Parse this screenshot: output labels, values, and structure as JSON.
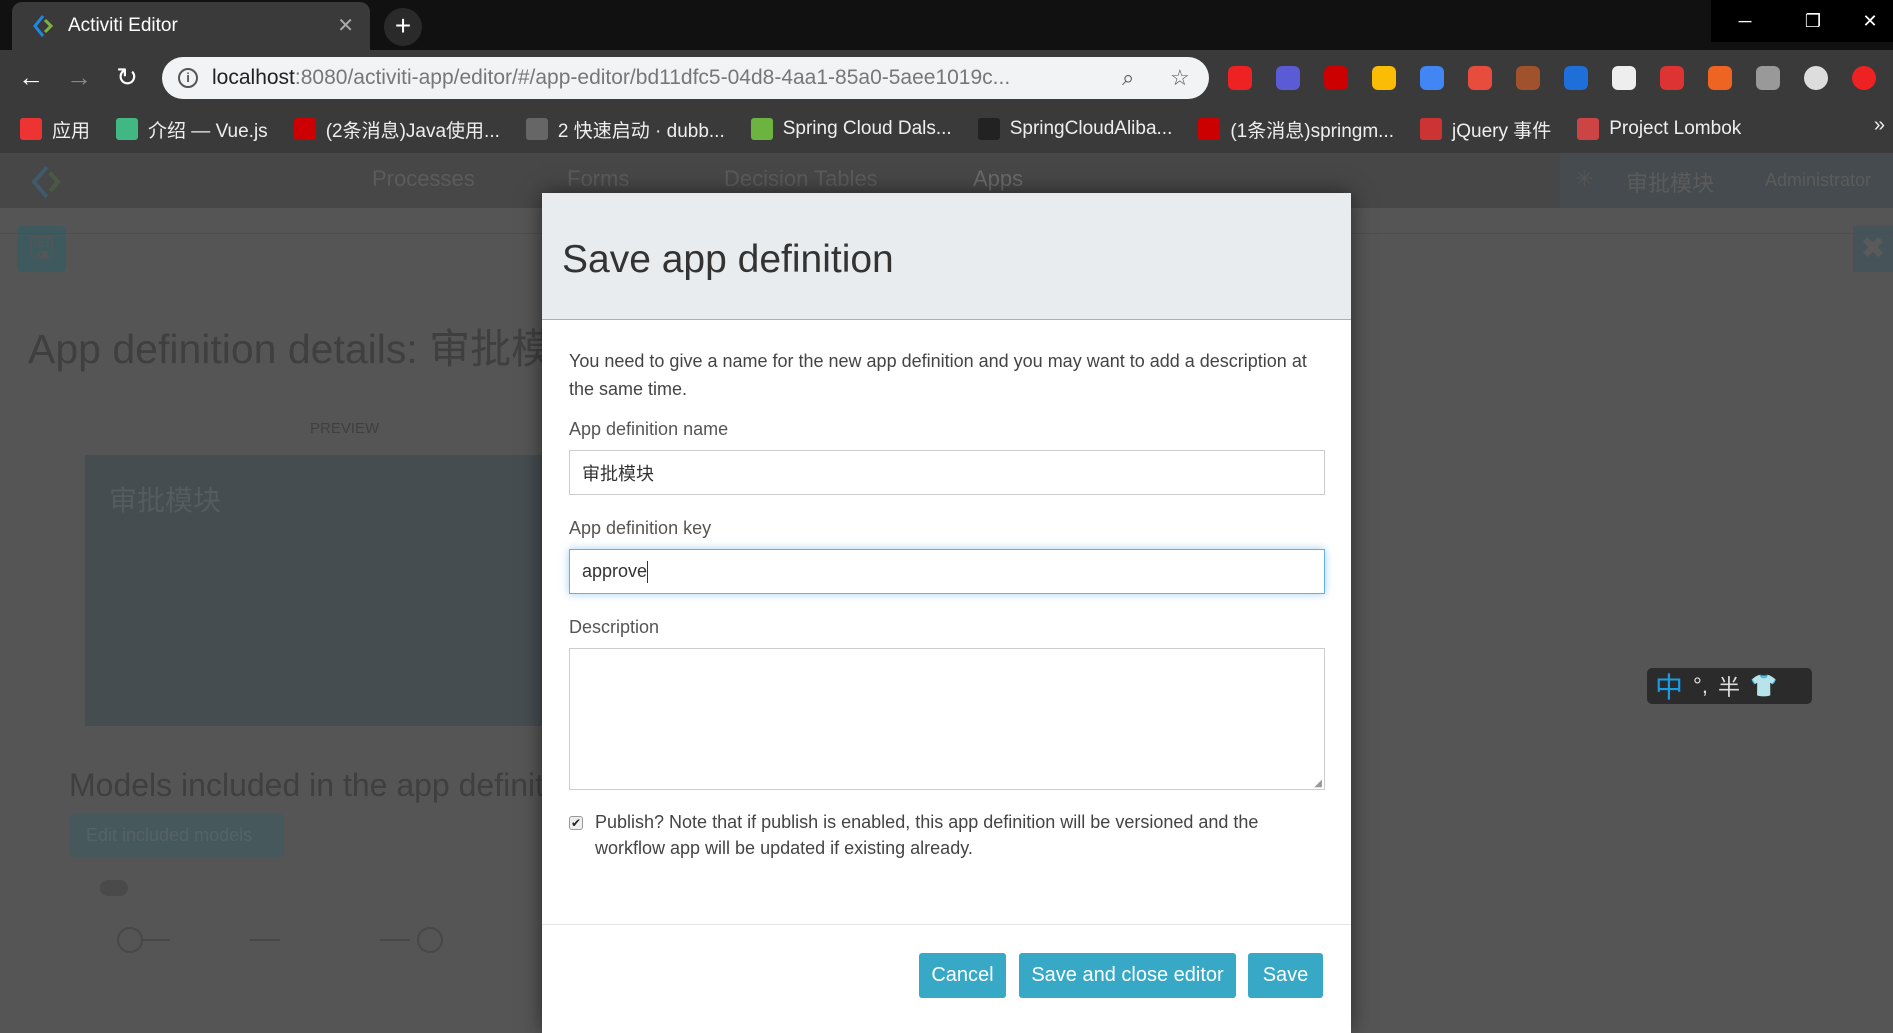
{
  "browser": {
    "tab_title": "Activiti Editor",
    "url_host": "localhost",
    "url_rest": ":8080/activiti-app/editor/#/app-editor/bd11dfc5-04d8-4aa1-85a0-5aee1019c...",
    "bookmarks": [
      {
        "label": "应用",
        "icon": "apps-grid-icon",
        "color": "#e33"
      },
      {
        "label": "介绍 — Vue.js",
        "icon": "vue-icon",
        "color": "#41b883"
      },
      {
        "label": "(2条消息)Java使用...",
        "icon": "csdn-icon",
        "color": "#c00"
      },
      {
        "label": "2 快速启动 · dubb...",
        "icon": "book-icon",
        "color": "#666"
      },
      {
        "label": "Spring Cloud Dals...",
        "icon": "spring-icon",
        "color": "#6db33f"
      },
      {
        "label": "SpringCloudAliba...",
        "icon": "github-icon",
        "color": "#222"
      },
      {
        "label": "(1条消息)springm...",
        "icon": "csdn-icon",
        "color": "#c00"
      },
      {
        "label": "jQuery 事件",
        "icon": "jquery-icon",
        "color": "#c33"
      },
      {
        "label": "Project Lombok",
        "icon": "lombok-icon",
        "color": "#c44"
      }
    ],
    "overflow": "»",
    "extensions": [
      "#e22",
      "#5b5bd6",
      "#c00",
      "#fbbc05",
      "#4285f4",
      "#e74c3c",
      "#a0522d",
      "#1e6fd9",
      "#eee",
      "#d33",
      "#f06423",
      "#999",
      "#ddd",
      "#e22"
    ]
  },
  "app": {
    "nav": [
      "Processes",
      "Forms",
      "Decision Tables",
      "Apps"
    ],
    "header_app": "审批模块",
    "user": "Administrator",
    "page_title": "App definition details: 审批模块",
    "preview_label": "PREVIEW",
    "tile_name": "审批模块",
    "models_title": "Models included in the app definition",
    "edit_models": "Edit included models"
  },
  "modal": {
    "title": "Save app definition",
    "intro": "You need to give a name for the new app definition and you may want to add a description at the same time.",
    "name_label": "App definition name",
    "name_value": "审批模块",
    "key_label": "App definition key",
    "key_value": "approve",
    "desc_label": "Description",
    "desc_value": "",
    "publish_checked": true,
    "publish_text": "Publish? Note that if publish is enabled, this app definition will be versioned and the workflow app will be updated if existing already.",
    "buttons": {
      "cancel": "Cancel",
      "save_close": "Save and close editor",
      "save": "Save"
    },
    "accent": "#37a8c5"
  },
  "ime": {
    "mode": "中",
    "punct": "°,",
    "width": "半"
  }
}
